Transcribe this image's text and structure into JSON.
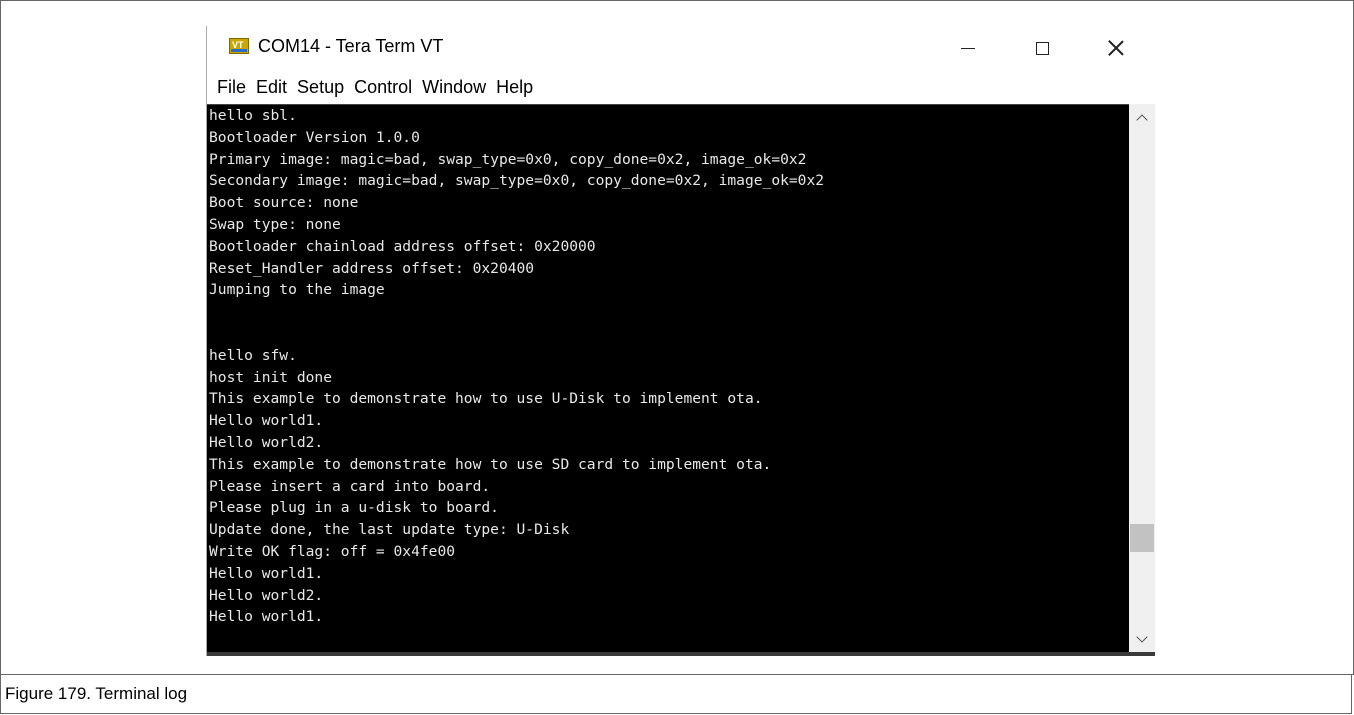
{
  "window": {
    "title": "COM14 - Tera Term VT",
    "icon": "tera-term-vt-icon"
  },
  "menu": [
    "File",
    "Edit",
    "Setup",
    "Control",
    "Window",
    "Help"
  ],
  "terminal": {
    "lines": [
      "hello sbl.",
      "Bootloader Version 1.0.0",
      "Primary image: magic=bad, swap_type=0x0, copy_done=0x2, image_ok=0x2",
      "Secondary image: magic=bad, swap_type=0x0, copy_done=0x2, image_ok=0x2",
      "Boot source: none",
      "Swap type: none",
      "Bootloader chainload address offset: 0x20000",
      "Reset_Handler address offset: 0x20400",
      "Jumping to the image",
      "",
      "",
      "hello sfw.",
      "host init done",
      "This example to demonstrate how to use U-Disk to implement ota.",
      "Hello world1.",
      "Hello world2.",
      "This example to demonstrate how to use SD card to implement ota.",
      "Please insert a card into board.",
      "Please plug in a u-disk to board.",
      "Update done, the last update type: U-Disk",
      "Write OK flag: off = 0x4fe00",
      "Hello world1.",
      "Hello world2.",
      "Hello world1."
    ]
  },
  "caption": "Figure 179. Terminal log",
  "colors": {
    "terminal_bg": "#000000",
    "terminal_fg": "#e8e8e8",
    "icon_bg": "#c8a800"
  }
}
